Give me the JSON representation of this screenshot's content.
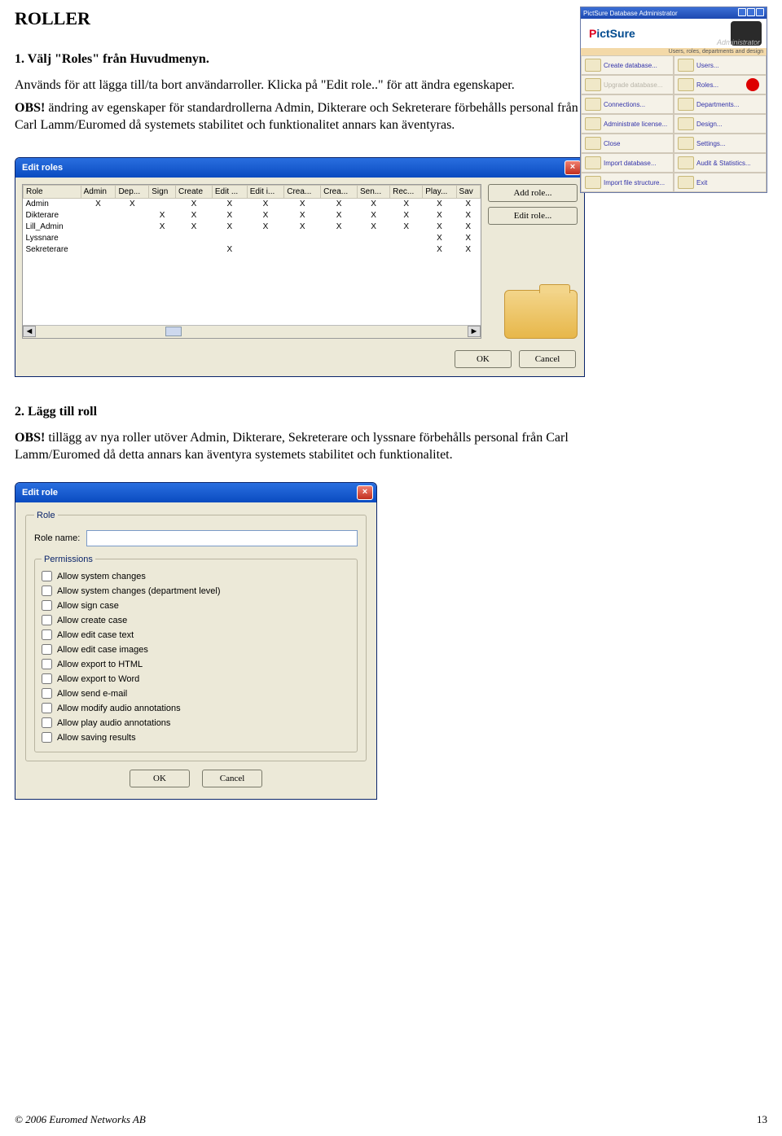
{
  "doc": {
    "title": "ROLLER",
    "step1": "1. Välj \"Roles\" från Huvudmenyn.",
    "para1": "Används för att lägga till/ta bort användarroller. Klicka på \"Edit role..\" för att ändra egenskaper.",
    "obs1_label": "OBS!",
    "obs1_text": " ändring av egenskaper för standardrollerna Admin, Dikterare och Sekreterare förbehålls personal från Carl Lamm/Euromed då systemets stabilitet och funktionalitet annars kan äventyras.",
    "step2": "2. Lägg till roll",
    "obs2_label": "OBS!",
    "obs2_text": " tillägg av nya roller utöver Admin, Dikterare, Sekreterare och lyssnare förbehålls personal från Carl Lamm/Euromed då detta annars kan äventyra systemets stabilitet och funktionalitet."
  },
  "admin_thumb": {
    "app_title": "PictSure Database Administrator",
    "logo_main": "ictSure",
    "logo_p": "P",
    "logo_sub": "Administrator",
    "banner": "Users, roles, departments and design",
    "cells": [
      {
        "label": "Create database...",
        "disabled": false
      },
      {
        "label": "Users...",
        "disabled": false
      },
      {
        "label": "Upgrade database...",
        "disabled": true
      },
      {
        "label": "Roles...",
        "disabled": false,
        "marker": true
      },
      {
        "label": "Connections...",
        "disabled": false
      },
      {
        "label": "Departments...",
        "disabled": false
      },
      {
        "label": "Administrate license...",
        "disabled": false
      },
      {
        "label": "Design...",
        "disabled": false
      },
      {
        "label": "Close",
        "disabled": false
      },
      {
        "label": "Settings...",
        "disabled": false
      },
      {
        "label": "Import database...",
        "disabled": false
      },
      {
        "label": "Audit & Statistics...",
        "disabled": false
      },
      {
        "label": "Import file structure...",
        "disabled": false
      },
      {
        "label": "Exit",
        "disabled": false
      }
    ]
  },
  "edit_roles": {
    "title": "Edit roles",
    "columns": [
      "Role",
      "Admin",
      "Dep...",
      "Sign",
      "Create",
      "Edit ...",
      "Edit i...",
      "Crea...",
      "Crea...",
      "Sen...",
      "Rec...",
      "Play...",
      "Sav"
    ],
    "rows": [
      {
        "name": "Admin",
        "cells": [
          "X",
          "X",
          "",
          "X",
          "X",
          "X",
          "X",
          "X",
          "X",
          "X",
          "X",
          "X"
        ]
      },
      {
        "name": "Dikterare",
        "cells": [
          "",
          "",
          "X",
          "X",
          "X",
          "X",
          "X",
          "X",
          "X",
          "X",
          "X",
          "X"
        ]
      },
      {
        "name": "Lill_Admin",
        "cells": [
          "",
          "",
          "X",
          "X",
          "X",
          "X",
          "X",
          "X",
          "X",
          "X",
          "X",
          "X"
        ]
      },
      {
        "name": "Lyssnare",
        "cells": [
          "",
          "",
          "",
          "",
          "",
          "",
          "",
          "",
          "",
          "",
          "X",
          "X"
        ]
      },
      {
        "name": "Sekreterare",
        "cells": [
          "",
          "",
          "",
          "",
          "X",
          "",
          "",
          "",
          "",
          "",
          "X",
          "X"
        ]
      }
    ],
    "add_role": "Add role...",
    "edit_role": "Edit role...",
    "ok": "OK",
    "cancel": "Cancel"
  },
  "edit_role": {
    "title": "Edit role",
    "group_role": "Role",
    "rolename_label": "Role name:",
    "rolename_value": "",
    "group_perms": "Permissions",
    "perms": [
      "Allow system changes",
      "Allow system changes (department level)",
      "Allow sign case",
      "Allow create case",
      "Allow edit case text",
      "Allow edit case images",
      "Allow export to HTML",
      "Allow export to Word",
      "Allow send e-mail",
      "Allow modify audio annotations",
      "Allow play audio annotations",
      "Allow saving results"
    ],
    "ok": "OK",
    "cancel": "Cancel"
  },
  "footer": {
    "copyright": "© 2006 Euromed Networks AB",
    "pagenum": "13"
  }
}
